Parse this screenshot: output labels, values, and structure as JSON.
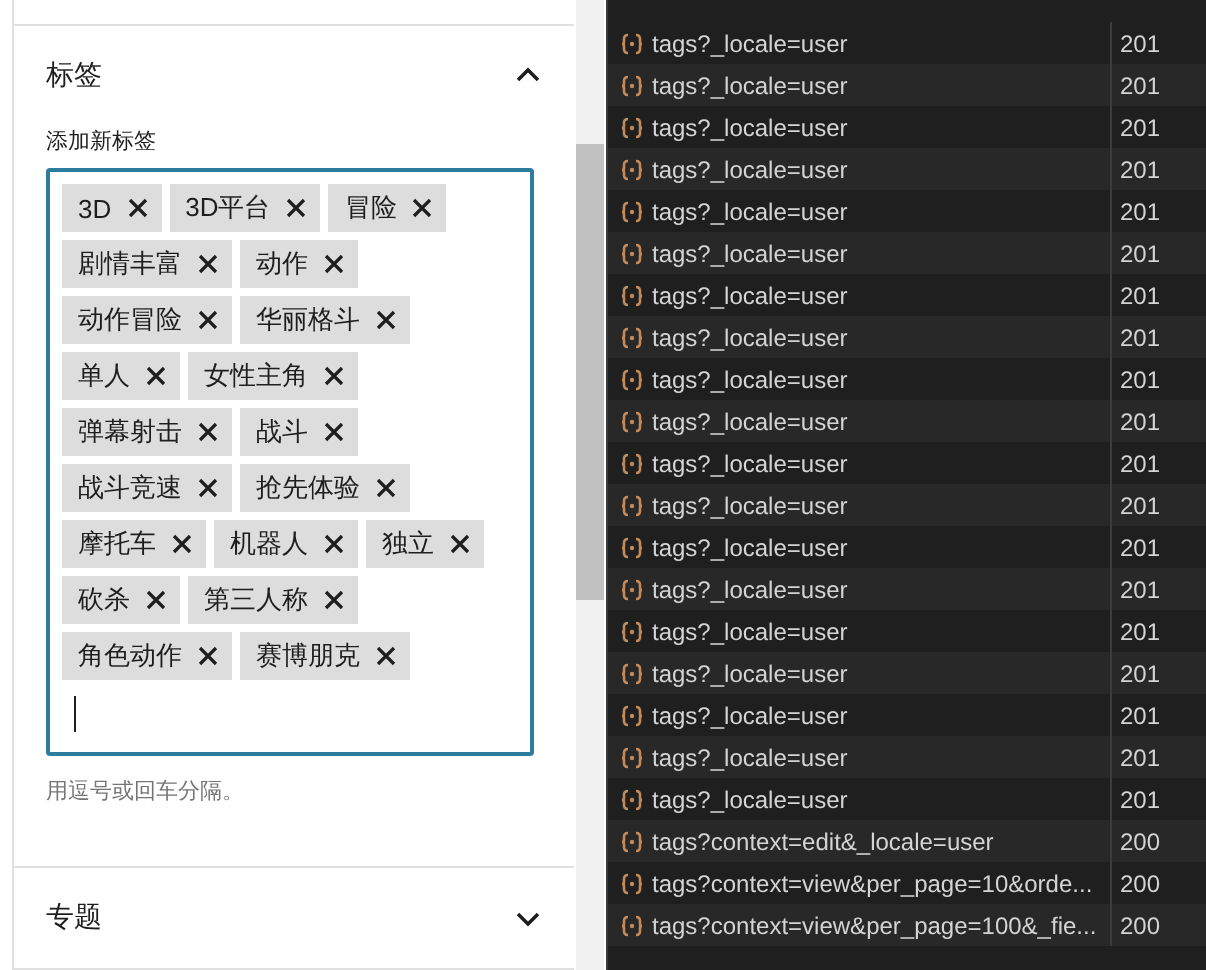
{
  "sidebar": {
    "sections": [
      {
        "title": "标签",
        "expanded": true,
        "field_label": "添加新标签",
        "tags": [
          "3D",
          "3D平台",
          "冒险",
          "剧情丰富",
          "动作",
          "动作冒险",
          "华丽格斗",
          "单人",
          "女性主角",
          "弹幕射击",
          "战斗",
          "战斗竞速",
          "抢先体验",
          "摩托车",
          "机器人",
          "独立",
          "砍杀",
          "第三人称",
          "角色动作",
          "赛博朋克"
        ],
        "help": "用逗号或回车分隔。"
      },
      {
        "title": "专题",
        "expanded": false
      }
    ]
  },
  "network": {
    "rows": [
      {
        "name": "tags?_locale=user",
        "status": "201"
      },
      {
        "name": "tags?_locale=user",
        "status": "201"
      },
      {
        "name": "tags?_locale=user",
        "status": "201"
      },
      {
        "name": "tags?_locale=user",
        "status": "201"
      },
      {
        "name": "tags?_locale=user",
        "status": "201"
      },
      {
        "name": "tags?_locale=user",
        "status": "201"
      },
      {
        "name": "tags?_locale=user",
        "status": "201"
      },
      {
        "name": "tags?_locale=user",
        "status": "201"
      },
      {
        "name": "tags?_locale=user",
        "status": "201"
      },
      {
        "name": "tags?_locale=user",
        "status": "201"
      },
      {
        "name": "tags?_locale=user",
        "status": "201"
      },
      {
        "name": "tags?_locale=user",
        "status": "201"
      },
      {
        "name": "tags?_locale=user",
        "status": "201"
      },
      {
        "name": "tags?_locale=user",
        "status": "201"
      },
      {
        "name": "tags?_locale=user",
        "status": "201"
      },
      {
        "name": "tags?_locale=user",
        "status": "201"
      },
      {
        "name": "tags?_locale=user",
        "status": "201"
      },
      {
        "name": "tags?_locale=user",
        "status": "201"
      },
      {
        "name": "tags?_locale=user",
        "status": "201"
      },
      {
        "name": "tags?context=edit&_locale=user",
        "status": "200"
      },
      {
        "name": "tags?context=view&per_page=10&orde...",
        "status": "200"
      },
      {
        "name": "tags?context=view&per_page=100&_fie...",
        "status": "200"
      }
    ]
  }
}
